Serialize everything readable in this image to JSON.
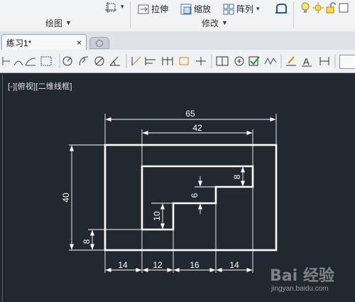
{
  "ribbon": {
    "panels": [
      {
        "label": "绘图"
      },
      {
        "label": "修改"
      }
    ],
    "buttons": {
      "stretch": "拉伸",
      "scale": "缩放",
      "array": "阵列"
    }
  },
  "tabs": {
    "active": "练习1*"
  },
  "viewport": {
    "label_a": "[-]",
    "label_b": "[俯视]",
    "label_c": "[二维线框]"
  },
  "drawing": {
    "dims": {
      "overall_width": "65",
      "inner_width": "42",
      "height": "40",
      "left_step": "8",
      "step1": "10",
      "step2": "6",
      "step3": "8",
      "seg1": "14",
      "seg2": "12",
      "seg3": "16",
      "seg4": "14"
    },
    "colors": {
      "background": "#212830",
      "lines": "#ffffff"
    }
  },
  "watermark": {
    "text": "Bai 经验",
    "url": "jingyan.baidu.com"
  }
}
